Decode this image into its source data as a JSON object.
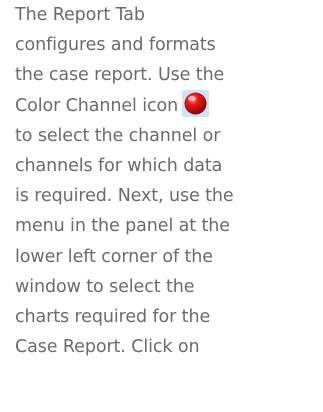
{
  "paragraph": {
    "lines": [
      "The Report Tab",
      "configures and formats",
      "the case report. Use the",
      "Color Channel icon",
      "to select the channel or",
      "channels for which data",
      "is required. Next, use the",
      "menu in the panel at the",
      "lower left corner of the",
      "window to select the",
      "charts required for the",
      "Case Report. Click on"
    ],
    "icon": "red-ball-icon"
  },
  "colors": {
    "text": "#6b6b6b",
    "icon_bg": "#cfe3f5",
    "icon_red": "#d41010"
  }
}
